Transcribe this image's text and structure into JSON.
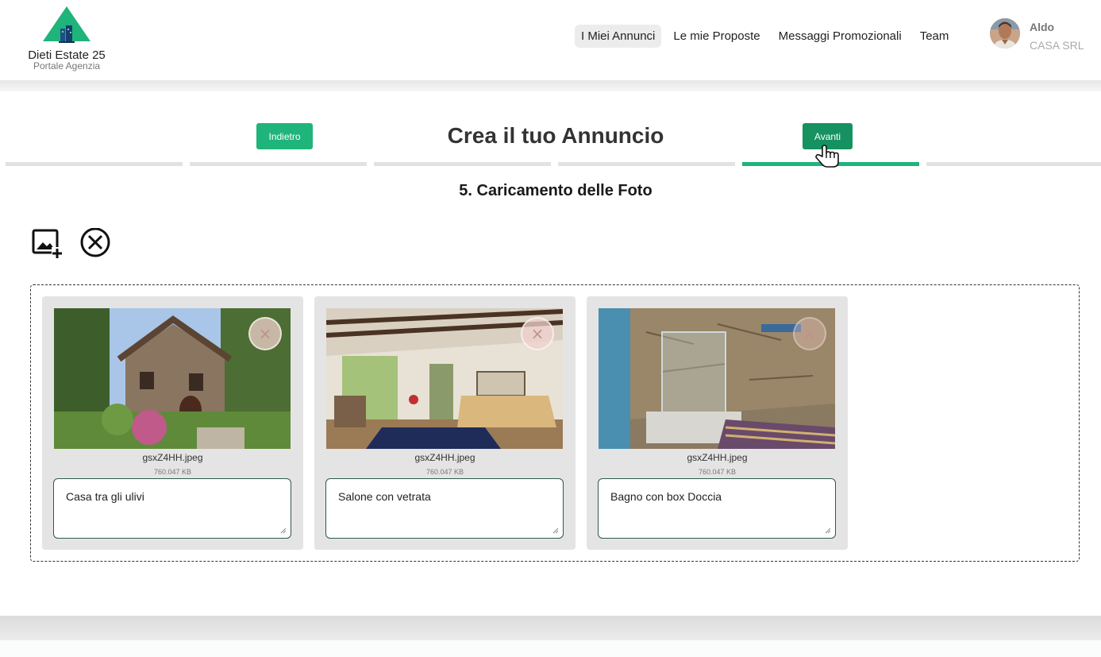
{
  "brand": {
    "name": "Dieti Estate 25",
    "subtitle": "Portale Agenzia",
    "accent": "#1fb47a"
  },
  "nav": {
    "items": [
      {
        "label": "I Miei Annunci",
        "active": true
      },
      {
        "label": "Le mie Proposte",
        "active": false
      },
      {
        "label": "Messaggi Promozionali",
        "active": false
      },
      {
        "label": "Team",
        "active": false
      }
    ]
  },
  "user": {
    "name": "Aldo",
    "company": "CASA SRL"
  },
  "wizard": {
    "title": "Crea il tuo Annuncio",
    "back_label": "Indietro",
    "next_label": "Avanti",
    "steps_total": 6,
    "current_step": 5,
    "section_title": "5. Caricamento delle Foto"
  },
  "toolbar": {
    "add_icon": "add-photo-icon",
    "clear_icon": "circle-x-icon"
  },
  "photos": [
    {
      "filename": "gsxZ4HH.jpeg",
      "size": "760.047 KB",
      "description": "Casa tra gli ulivi"
    },
    {
      "filename": "gsxZ4HH.jpeg",
      "size": "760.047 KB",
      "description": "Salone con vetrata"
    },
    {
      "filename": "gsxZ4HH.jpeg",
      "size": "760.047 KB",
      "description": "Bagno con box Doccia"
    }
  ],
  "remove_glyph": "×"
}
